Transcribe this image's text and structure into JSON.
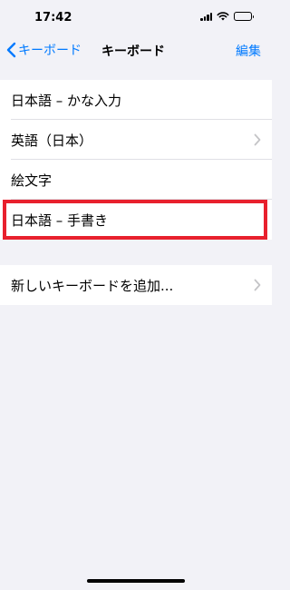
{
  "status_bar": {
    "time": "17:42",
    "battery_level": 0.3,
    "icons": [
      "signal-icon",
      "wifi-icon",
      "battery-icon"
    ]
  },
  "nav": {
    "back_label": "キーボード",
    "title": "キーボード",
    "edit_label": "編集"
  },
  "keyboards": [
    {
      "label": "日本語 – かな入力",
      "has_chevron": false
    },
    {
      "label": "英語（日本）",
      "has_chevron": true
    },
    {
      "label": "絵文字",
      "has_chevron": false
    },
    {
      "label": "日本語 – 手書き",
      "has_chevron": false,
      "highlighted": true
    }
  ],
  "add_keyboard": {
    "label": "新しいキーボードを追加...",
    "has_chevron": true
  },
  "colors": {
    "accent": "#007aff",
    "highlight": "#e8202d",
    "background": "#f2f2f7",
    "chevron": "#c4c4c7"
  }
}
